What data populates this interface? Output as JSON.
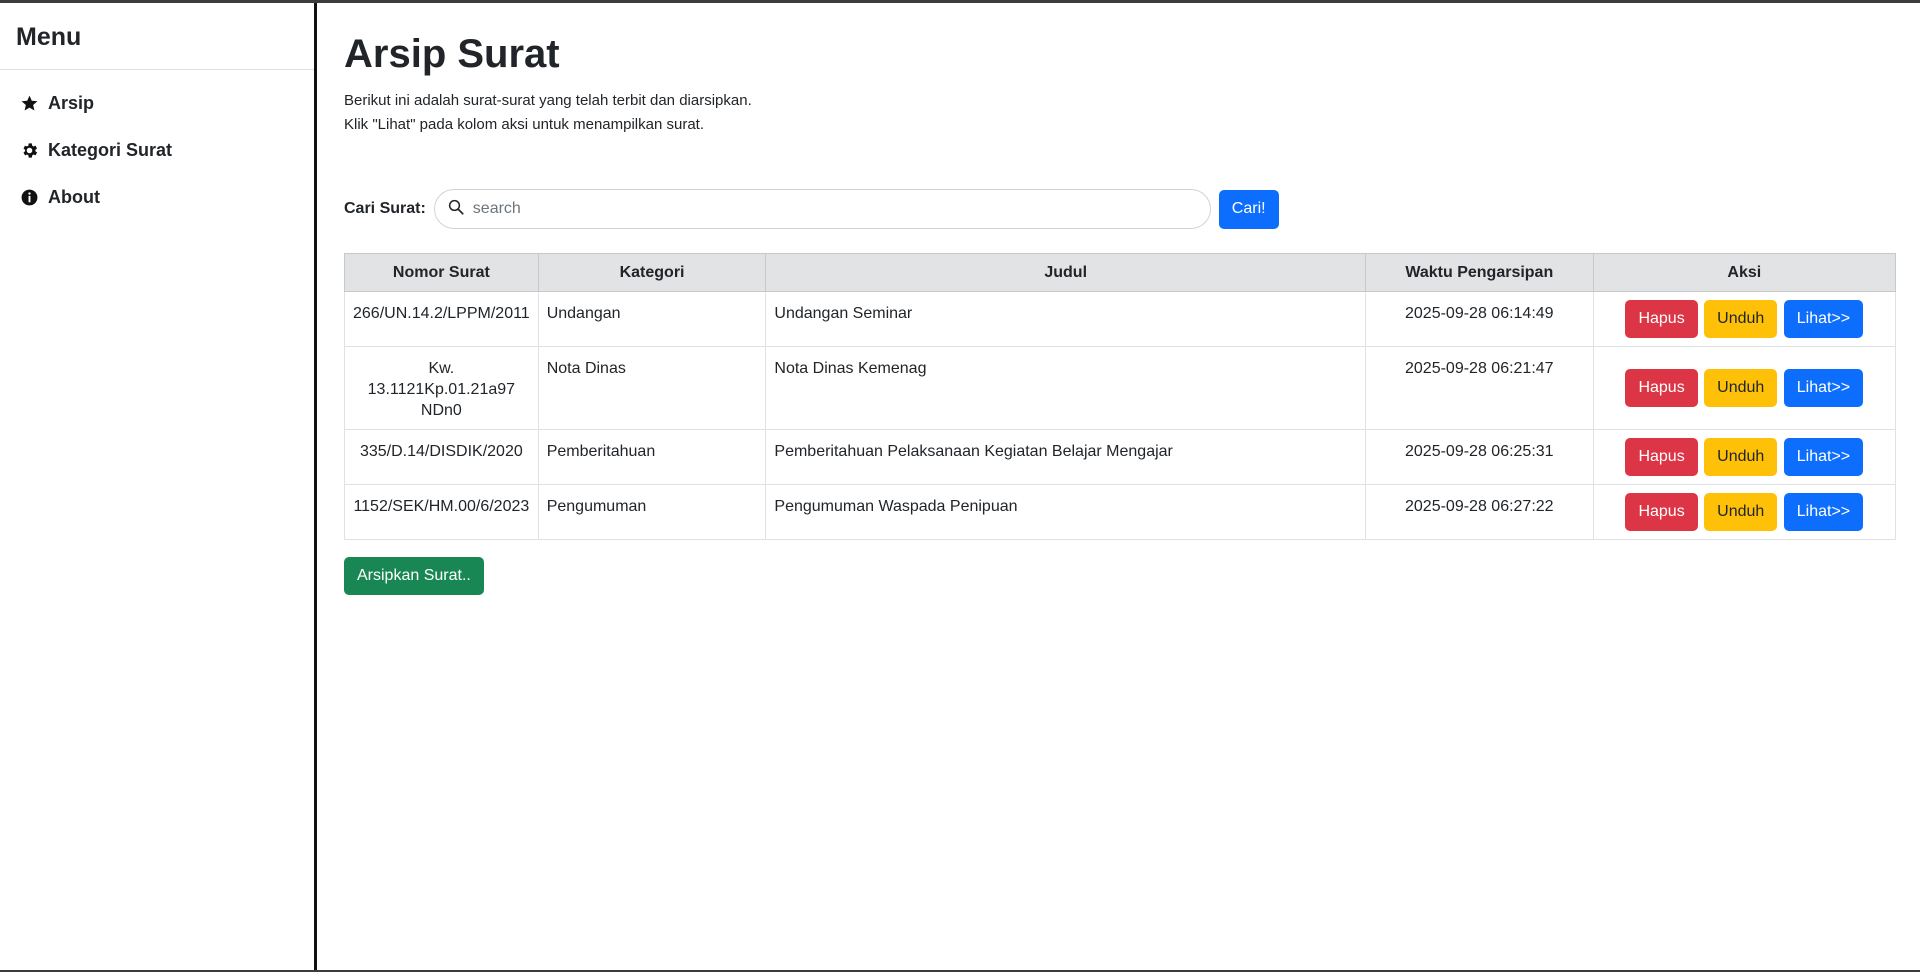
{
  "sidebar": {
    "title": "Menu",
    "items": [
      {
        "label": "Arsip",
        "icon": "star-icon"
      },
      {
        "label": "Kategori Surat",
        "icon": "gear-icon"
      },
      {
        "label": "About",
        "icon": "info-icon"
      }
    ]
  },
  "main": {
    "title": "Arsip Surat",
    "description_line1": "Berikut ini adalah surat-surat yang telah terbit dan diarsipkan.",
    "description_line2": "Klik \"Lihat\" pada kolom aksi untuk menampilkan surat.",
    "search": {
      "label": "Cari Surat:",
      "placeholder": "search",
      "value": "",
      "button_label": "Cari!"
    },
    "table": {
      "headers": [
        "Nomor Surat",
        "Kategori",
        "Judul",
        "Waktu Pengarsipan",
        "Aksi"
      ],
      "rows": [
        {
          "nomor": "266/UN.14.2/LPPM/2011",
          "kategori": "Undangan",
          "judul": "Undangan Seminar",
          "waktu": "2025-09-28 06:14:49"
        },
        {
          "nomor": "Kw. 13.1121Kp.01.21a97 NDn0",
          "kategori": "Nota Dinas",
          "judul": "Nota Dinas Kemenag",
          "waktu": "2025-09-28 06:21:47"
        },
        {
          "nomor": "335/D.14/DISDIK/2020",
          "kategori": "Pemberitahuan",
          "judul": "Pemberitahuan Pelaksanaan Kegiatan Belajar Mengajar",
          "waktu": "2025-09-28 06:25:31"
        },
        {
          "nomor": "1152/SEK/HM.00/6/2023",
          "kategori": "Pengumuman",
          "judul": "Pengumuman Waspada Penipuan",
          "waktu": "2025-09-28 06:27:22"
        }
      ],
      "actions": {
        "delete": "Hapus",
        "download": "Unduh",
        "view": "Lihat>>"
      }
    },
    "archive_button": "Arsipkan Surat.."
  },
  "colors": {
    "primary": "#0d6efd",
    "danger": "#dc3545",
    "warning": "#ffc107",
    "success": "#198754",
    "table_header": "#e2e3e5"
  }
}
